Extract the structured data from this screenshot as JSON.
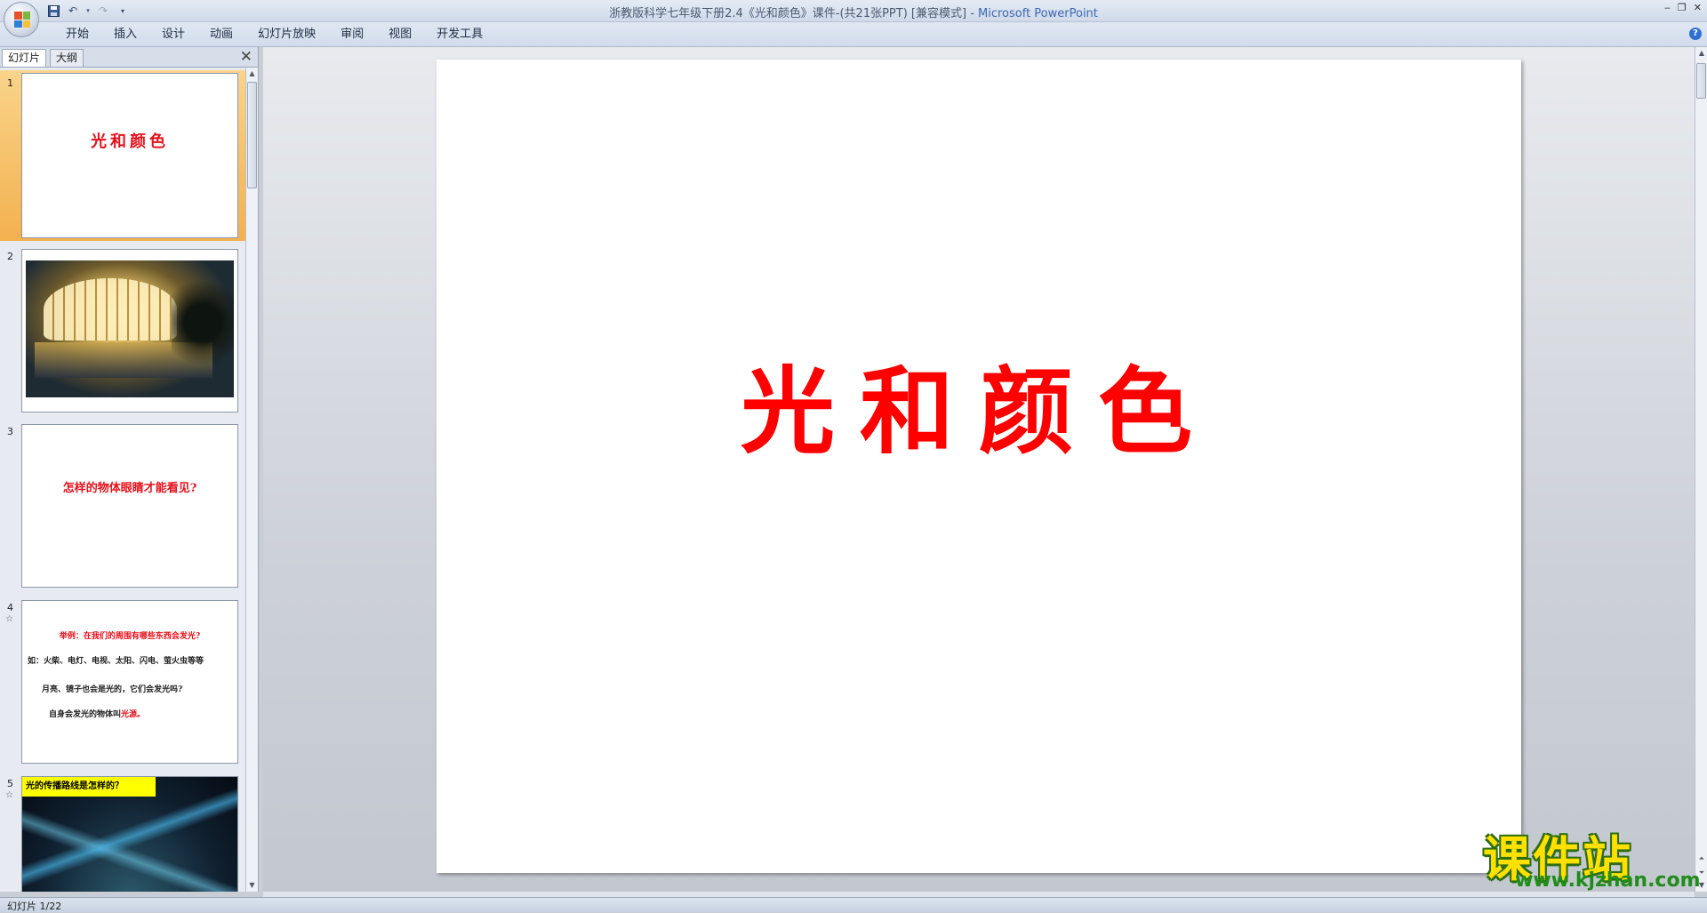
{
  "window": {
    "title": "浙教版科学七年级下册2.4《光和颜色》课件-(共21张PPT) [兼容模式] - ",
    "app_name": "Microsoft PowerPoint"
  },
  "ribbon": {
    "tabs": [
      "开始",
      "插入",
      "设计",
      "动画",
      "幻灯片放映",
      "审阅",
      "视图",
      "开发工具"
    ]
  },
  "left_pane": {
    "tabs": [
      "幻灯片",
      "大纲"
    ],
    "active_tab": "幻灯片"
  },
  "thumbnails": [
    {
      "number": "1",
      "title": "光和颜色"
    },
    {
      "number": "2"
    },
    {
      "number": "3",
      "text": "怎样的物体眼睛才能看见?"
    },
    {
      "number": "4",
      "lines": [
        "举例：在我们的周围有哪些东西会发光?",
        "如：火柴、电灯、电视、太阳、闪电、萤火虫等等",
        "月亮、镜子也会是光的，它们会发光吗?",
        "自身会发光的物体叫",
        "光源。"
      ]
    },
    {
      "number": "5",
      "banner": "光的传播路线是怎样的？"
    }
  ],
  "main_slide": {
    "title": "光和颜色"
  },
  "status": {
    "text": "幻灯片 1/22"
  },
  "watermark": {
    "brand": "课件站",
    "url": "www.kjzhan.com"
  },
  "colors": {
    "title_red": "#ff0000",
    "selection_orange": "#f3b14f",
    "watermark_yellow": "#ffe000",
    "watermark_green": "#1f8d1a"
  }
}
